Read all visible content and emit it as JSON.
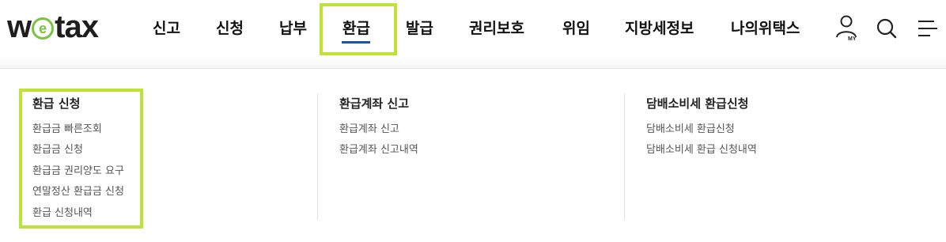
{
  "brand": {
    "logo_w": "w",
    "logo_e": "e",
    "logo_tax": "tax",
    "accent_color": "#7cc242",
    "highlight_color": "#bde337",
    "active_underline_color": "#1657a8"
  },
  "nav": {
    "items": [
      {
        "label": "신고"
      },
      {
        "label": "신청"
      },
      {
        "label": "납부"
      },
      {
        "label": "환급",
        "active": true
      },
      {
        "label": "발급"
      },
      {
        "label": "권리보호"
      },
      {
        "label": "위임"
      },
      {
        "label": "지방세정보"
      },
      {
        "label": "나의위택스"
      }
    ]
  },
  "utility": {
    "my_label": "MY",
    "icons": [
      "user-icon",
      "search-icon",
      "menu-icon"
    ]
  },
  "megamenu": {
    "groups": [
      {
        "title": "환급 신청",
        "links": [
          "환급금 빠른조회",
          "환급금 신청",
          "환급금 권리양도 요구",
          "연말정산 환급금 신청",
          "환급 신청내역"
        ]
      },
      {
        "title": "환급계좌 신고",
        "links": [
          "환급계좌 신고",
          "환급계좌 신고내역"
        ]
      },
      {
        "title": "담배소비세 환급신청",
        "links": [
          "담배소비세 환급신청",
          "담배소비세 환급 신청내역"
        ]
      }
    ]
  }
}
